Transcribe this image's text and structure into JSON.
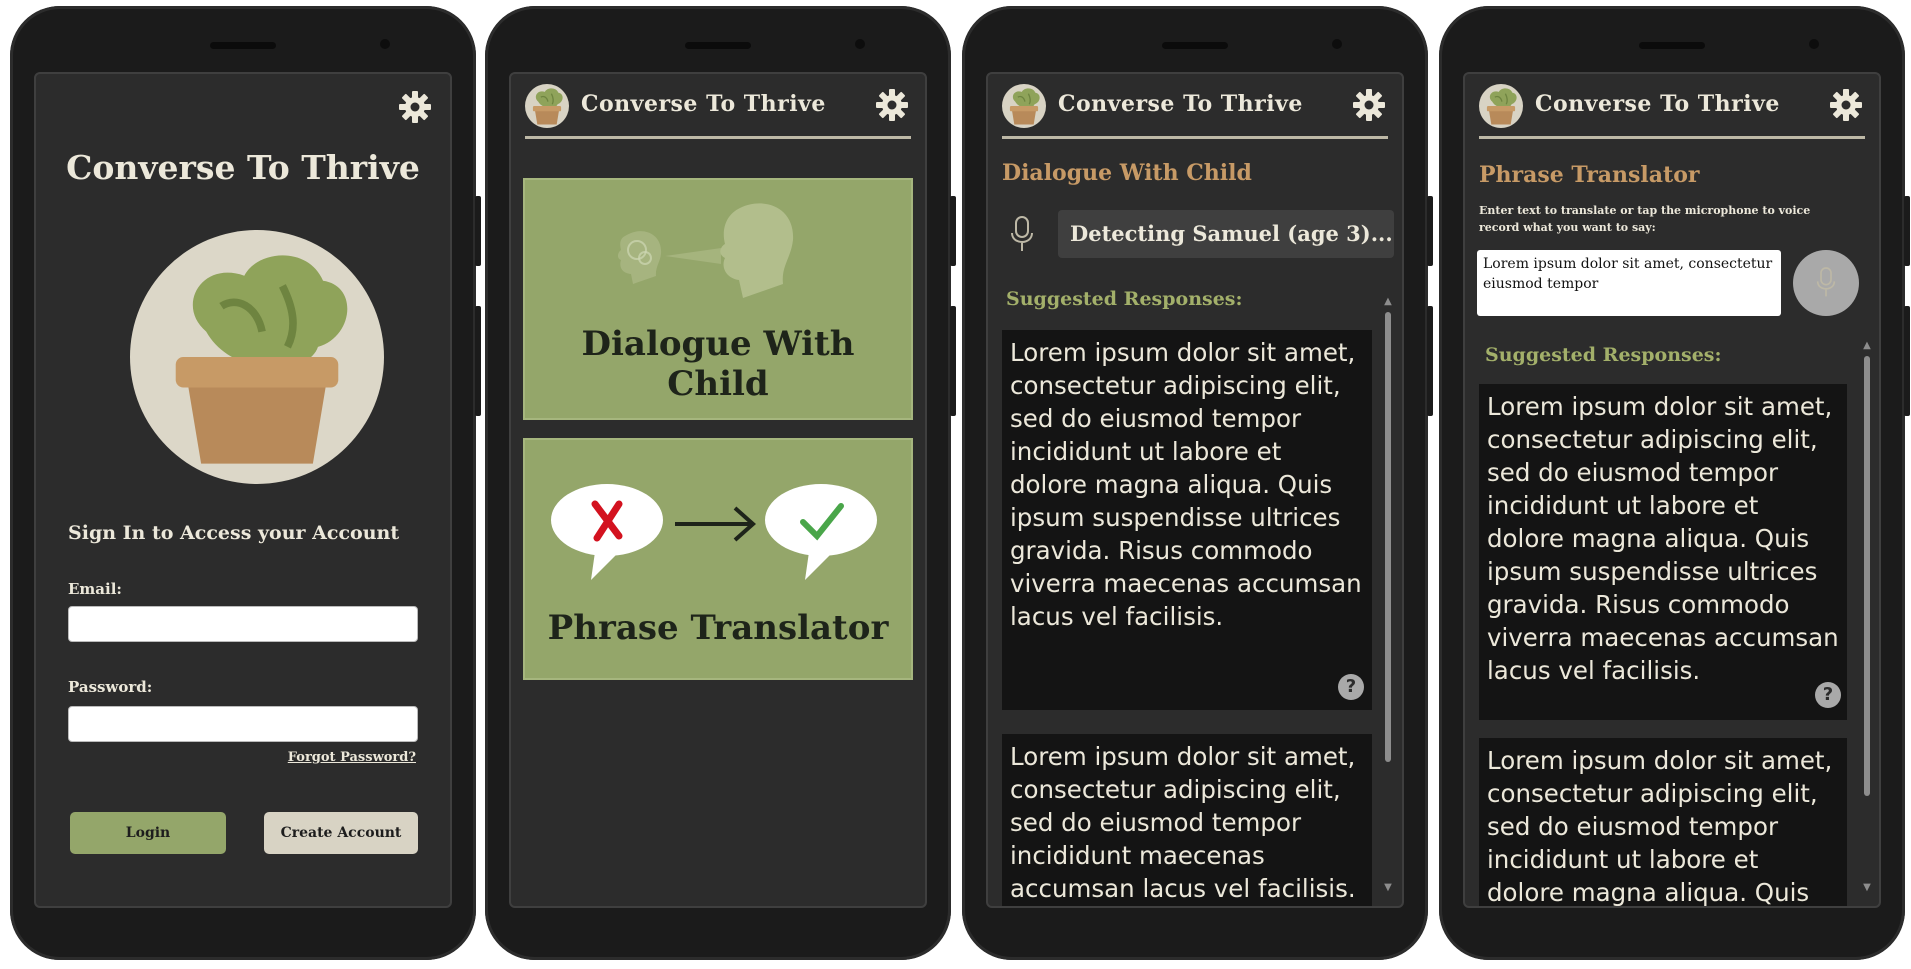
{
  "app_name": "Converse To Thrive",
  "colors": {
    "background": "#2c2c2c",
    "card_green": "#94a66a",
    "section_title": "#c79a66",
    "suggested_title": "#a3b06a",
    "login_button": "#94a66a",
    "create_button": "#d8d3c4",
    "wrong_mark": "#d3121f",
    "right_mark": "#4aa64a"
  },
  "login": {
    "heading": "Converse To Thrive",
    "subtitle": "Sign In to Access your Account",
    "email_label": "Email:",
    "email_value": "",
    "password_label": "Password:",
    "password_value": "",
    "forgot_link": "Forgot Password?",
    "login_button": "Login",
    "create_button": "Create Account"
  },
  "home": {
    "cards": [
      {
        "label": "Dialogue With Child",
        "icon": "two-heads-talking-icon"
      },
      {
        "label": "Phrase Translator",
        "icon": "speech-bubbles-wrong-to-right-icon"
      }
    ]
  },
  "dialogue": {
    "section_title": "Dialogue With Child",
    "mic_icon": "microphone-icon",
    "detecting_text": "Detecting Samuel (age 3)...",
    "suggested_title": "Suggested Responses:",
    "responses": [
      "Lorem ipsum dolor sit amet, consectetur adipiscing elit, sed do eiusmod tempor incididunt ut labore et dolore magna aliqua. Quis ipsum suspendisse ultrices gravida. Risus commodo viverra maecenas accumsan lacus vel facilisis.",
      "Lorem ipsum dolor sit amet, consectetur adipiscing elit, sed do eiusmod tempor incididunt maecenas accumsan lacus vel facilisis.  consectetur"
    ],
    "help_icon": "?"
  },
  "translator": {
    "section_title": "Phrase Translator",
    "instructions": "Enter text to translate or tap the microphone to voice record what you want to say:",
    "input_value": "Lorem ipsum dolor sit amet, consectetur eiusmod tempor",
    "mic_icon": "microphone-icon",
    "suggested_title": "Suggested Responses:",
    "responses": [
      "Lorem ipsum dolor sit amet, consectetur adipiscing elit, sed do eiusmod tempor incididunt ut labore et dolore magna aliqua. Quis ipsum suspendisse ultrices gravida. Risus commodo viverra maecenas accumsan lacus vel facilisis.",
      "Lorem ipsum dolor sit amet, consectetur adipiscing elit, sed do eiusmod tempor incididunt ut labore et dolore magna aliqua. Quis ipsum"
    ],
    "help_icon": "?"
  }
}
